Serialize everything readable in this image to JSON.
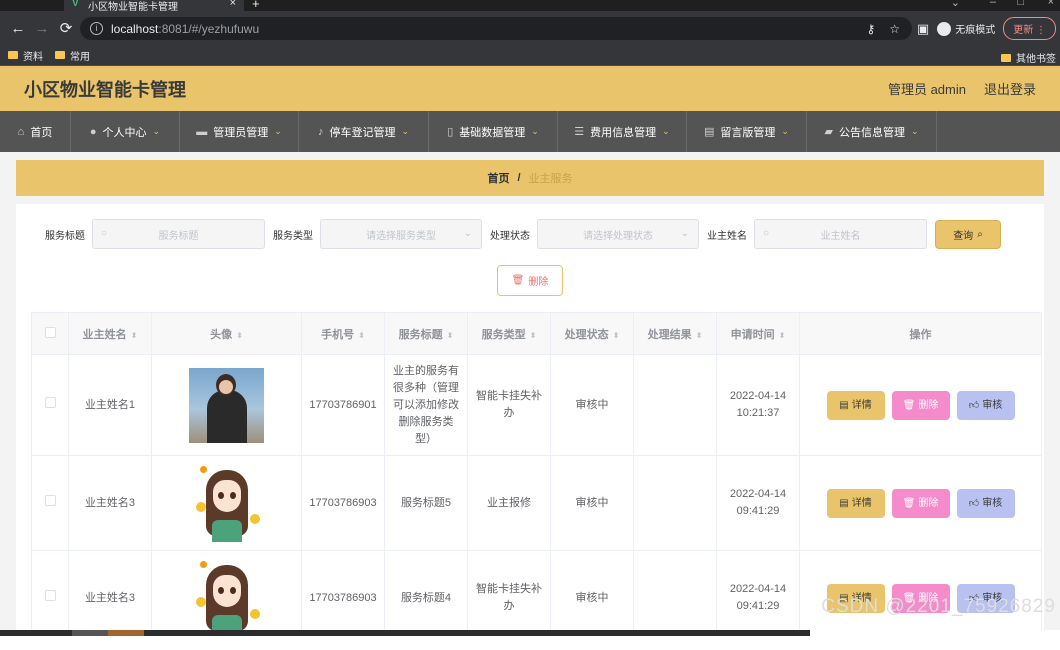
{
  "browser": {
    "tab_title": "小区物业智能卡管理",
    "url_host": "localhost",
    "url_path": ":8081/#/yezhufuwu",
    "incognito_label": "无痕模式",
    "update_label": "更新",
    "bookmarks": [
      "资料",
      "常用"
    ],
    "other_bookmarks": "其他书签"
  },
  "header": {
    "title": "小区物业智能卡管理",
    "user": "管理员 admin",
    "logout": "退出登录"
  },
  "nav": [
    {
      "label": "首页",
      "icon": "home-icon",
      "has_caret": false
    },
    {
      "label": "个人中心",
      "icon": "user-icon",
      "has_caret": true
    },
    {
      "label": "管理员管理",
      "icon": "admin-icon",
      "has_caret": true
    },
    {
      "label": "停车登记管理",
      "icon": "bell-icon",
      "has_caret": true
    },
    {
      "label": "基础数据管理",
      "icon": "phone-icon",
      "has_caret": true
    },
    {
      "label": "费用信息管理",
      "icon": "sliders-icon",
      "has_caret": true
    },
    {
      "label": "留言版管理",
      "icon": "message-icon",
      "has_caret": true
    },
    {
      "label": "公告信息管理",
      "icon": "notice-icon",
      "has_caret": true
    }
  ],
  "breadcrumb": {
    "home": "首页",
    "separator": "/",
    "current": "业主服务"
  },
  "filters": {
    "title_label": "服务标题",
    "title_placeholder": "服务标题",
    "type_label": "服务类型",
    "type_placeholder": "请选择服务类型",
    "status_label": "处理状态",
    "status_placeholder": "请选择处理状态",
    "owner_label": "业主姓名",
    "owner_placeholder": "业主姓名",
    "query_label": "查询"
  },
  "delete_label": "删除",
  "table": {
    "headers": [
      "业主姓名",
      "头像",
      "手机号",
      "服务标题",
      "服务类型",
      "处理状态",
      "处理结果",
      "申请时间",
      "操作"
    ],
    "rows": [
      {
        "name": "业主姓名1",
        "avatar": "photo",
        "phone": "17703786901",
        "title": "业主的服务有很多种（管理可以添加修改删除服务类型）",
        "type": "智能卡挂失补办",
        "status": "审核中",
        "result": "",
        "time": "2022-04-14 10:21:37"
      },
      {
        "name": "业主姓名3",
        "avatar": "anime",
        "phone": "17703786903",
        "title": "服务标题5",
        "type": "业主报修",
        "status": "审核中",
        "result": "",
        "time": "2022-04-14 09:41:29"
      },
      {
        "name": "业主姓名3",
        "avatar": "anime",
        "phone": "17703786903",
        "title": "服务标题4",
        "type": "智能卡挂失补办",
        "status": "审核中",
        "result": "",
        "time": "2022-04-14 09:41:29"
      }
    ],
    "actions": {
      "detail": "详情",
      "delete": "删除",
      "audit": "审核"
    }
  },
  "watermark": "CSDN @2201_75926829",
  "colors": {
    "accent": "#e9c46a",
    "nav_bg": "#545454",
    "delete_pink": "#f58bcb",
    "audit_blue": "#b8c1f0"
  }
}
